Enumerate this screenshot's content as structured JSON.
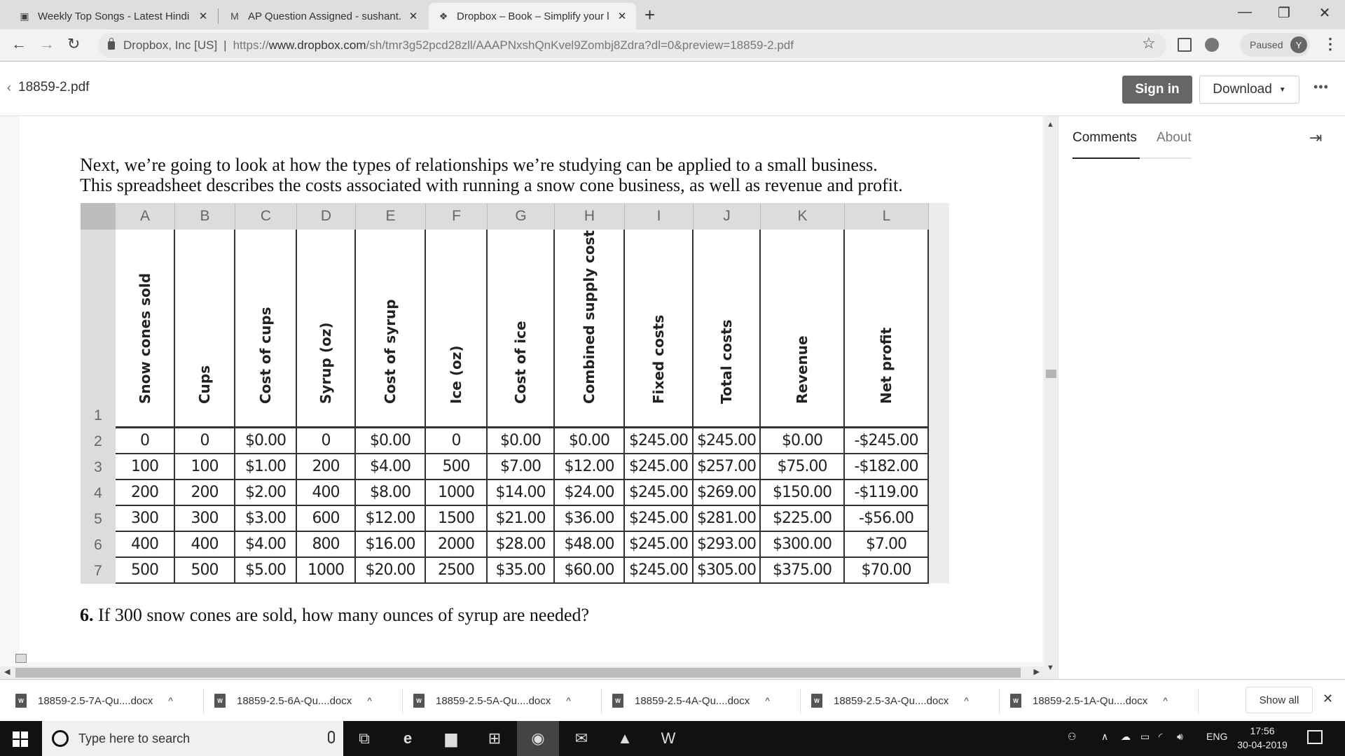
{
  "browser": {
    "tabs": [
      {
        "title": "Weekly Top Songs - Latest Hindi",
        "icon": "jiosaavn-icon",
        "active": false
      },
      {
        "title": "AP Question Assigned - sushant.",
        "icon": "gmail-icon",
        "active": false
      },
      {
        "title": "Dropbox – Book – Simplify your l",
        "icon": "dropbox-icon",
        "active": true
      }
    ],
    "new_tab_label": "+",
    "address": {
      "site_identity": "Dropbox, Inc [US]",
      "url_scheme": "https://",
      "url_host": "www.dropbox.com",
      "url_path": "/sh/tmr3g52pcd28zll/AAAPNxshQnKvel9Zombj8Zdra?dl=0&preview=18859-2.pdf"
    },
    "profile": {
      "status": "Paused",
      "initial": "Y"
    }
  },
  "dropbox": {
    "file_name": "18859-2.pdf",
    "sign_in_label": "Sign in",
    "download_label": "Download",
    "more_label": "•••",
    "side_panel": {
      "tabs": [
        {
          "label": "Comments",
          "active": true
        },
        {
          "label": "About",
          "active": false
        }
      ]
    }
  },
  "document": {
    "intro_line1": "Next, we’re going to look at how the types of relationships we’re studying can be applied to a small business.",
    "intro_line2": "This spreadsheet describes the costs associated with running a snow cone business, as well as revenue and profit.",
    "question_number": "6.",
    "question_text": "If 300 snow cones are sold, how many ounces of syrup are needed?",
    "spreadsheet": {
      "column_letters": [
        "A",
        "B",
        "C",
        "D",
        "E",
        "F",
        "G",
        "H",
        "I",
        "J",
        "K",
        "L"
      ],
      "row_numbers": [
        "1",
        "2",
        "3",
        "4",
        "5",
        "6",
        "7"
      ],
      "headers": [
        "Snow cones sold",
        "Cups",
        "Cost of cups",
        "Syrup (oz)",
        "Cost of syrup",
        "Ice (oz)",
        "Cost of ice",
        "Combined supply costs",
        "Fixed costs",
        "Total costs",
        "Revenue",
        "Net profit"
      ],
      "rows": [
        [
          "0",
          "0",
          "$0.00",
          "0",
          "$0.00",
          "0",
          "$0.00",
          "$0.00",
          "$245.00",
          "$245.00",
          "$0.00",
          "-$245.00"
        ],
        [
          "100",
          "100",
          "$1.00",
          "200",
          "$4.00",
          "500",
          "$7.00",
          "$12.00",
          "$245.00",
          "$257.00",
          "$75.00",
          "-$182.00"
        ],
        [
          "200",
          "200",
          "$2.00",
          "400",
          "$8.00",
          "1000",
          "$14.00",
          "$24.00",
          "$245.00",
          "$269.00",
          "$150.00",
          "-$119.00"
        ],
        [
          "300",
          "300",
          "$3.00",
          "600",
          "$12.00",
          "1500",
          "$21.00",
          "$36.00",
          "$245.00",
          "$281.00",
          "$225.00",
          "-$56.00"
        ],
        [
          "400",
          "400",
          "$4.00",
          "800",
          "$16.00",
          "2000",
          "$28.00",
          "$48.00",
          "$245.00",
          "$293.00",
          "$300.00",
          "$7.00"
        ],
        [
          "500",
          "500",
          "$5.00",
          "1000",
          "$20.00",
          "2500",
          "$35.00",
          "$60.00",
          "$245.00",
          "$305.00",
          "$375.00",
          "$70.00"
        ]
      ]
    }
  },
  "downloads": {
    "items": [
      "18859-2.5-7A-Qu....docx",
      "18859-2.5-6A-Qu....docx",
      "18859-2.5-5A-Qu....docx",
      "18859-2.5-4A-Qu....docx",
      "18859-2.5-3A-Qu....docx",
      "18859-2.5-1A-Qu....docx"
    ],
    "show_all_label": "Show all"
  },
  "taskbar": {
    "search_placeholder": "Type here to search",
    "language": "ENG",
    "time": "17:56",
    "date": "30-04-2019"
  }
}
